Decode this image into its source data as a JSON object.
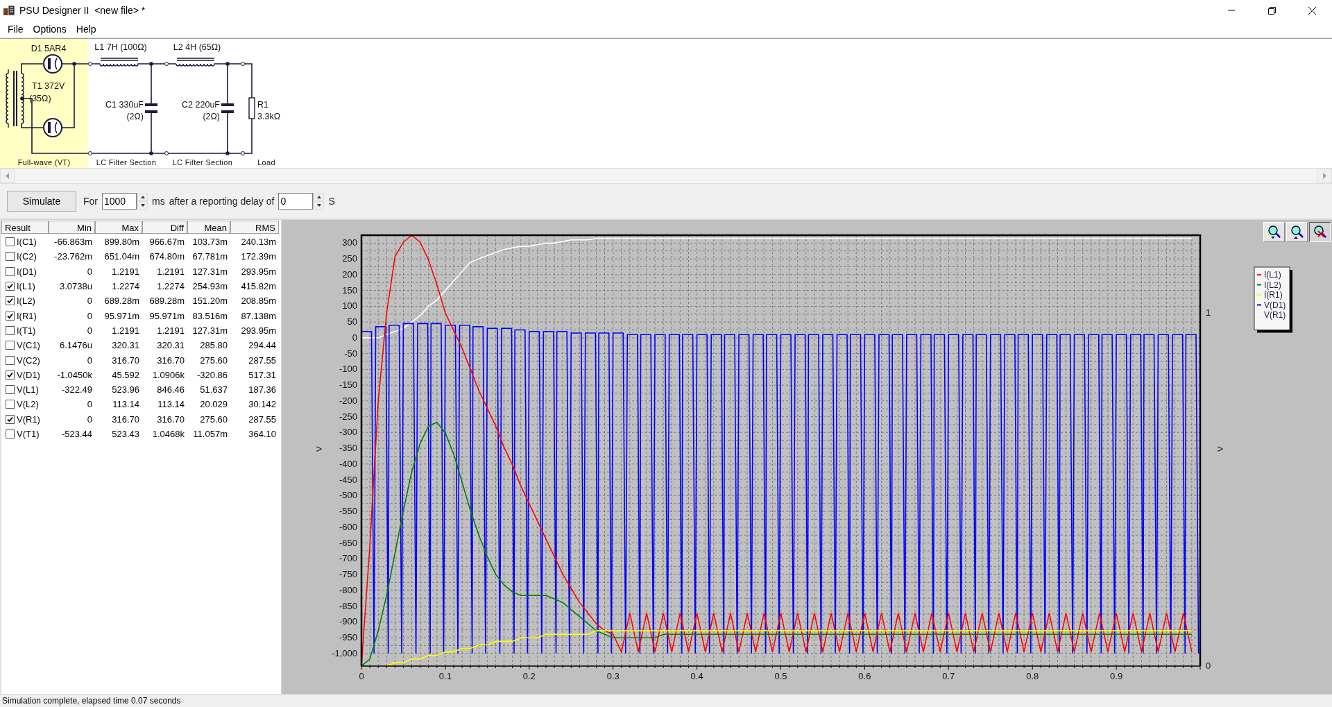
{
  "window": {
    "title": "PSU Designer II  <new file> *"
  },
  "menu": [
    "File",
    "Options",
    "Help"
  ],
  "schematic": {
    "sections": [
      {
        "kind": "rectifier",
        "label": "Full-wave (VT)",
        "selected": true,
        "tube": "D1 5AR4",
        "transformer": [
          "T1 372V",
          "(35Ω)"
        ]
      },
      {
        "kind": "lc_filter",
        "label": "LC Filter Section",
        "selected": false,
        "inductor": "L1 7H (100Ω)",
        "capacitor": [
          "C1 330uF",
          "(2Ω)"
        ]
      },
      {
        "kind": "lc_filter",
        "label": "LC Filter Section",
        "selected": false,
        "inductor": "L2 4H (65Ω)",
        "capacitor": [
          "C2 220uF",
          "(2Ω)"
        ]
      },
      {
        "kind": "load",
        "label": "Load",
        "selected": false,
        "resistor": [
          "R1",
          "3.3kΩ"
        ]
      }
    ]
  },
  "simulation": {
    "button": "Simulate",
    "for_label": "For",
    "duration": "1000",
    "duration_unit": "ms",
    "delay_label": "after a reporting delay of",
    "delay": "0",
    "delay_unit": "S"
  },
  "results": {
    "columns": [
      "Result",
      "Min",
      "Max",
      "Diff",
      "Mean",
      "RMS"
    ],
    "rows": [
      {
        "name": "I(C1)",
        "checked": false,
        "min": "-66.863m",
        "max": "899.80m",
        "diff": "966.67m",
        "mean": "103.73m",
        "rms": "240.13m"
      },
      {
        "name": "I(C2)",
        "checked": false,
        "min": "-23.762m",
        "max": "651.04m",
        "diff": "674.80m",
        "mean": "67.781m",
        "rms": "172.39m"
      },
      {
        "name": "I(D1)",
        "checked": false,
        "min": "0",
        "max": "1.2191",
        "diff": "1.2191",
        "mean": "127.31m",
        "rms": "293.95m"
      },
      {
        "name": "I(L1)",
        "checked": true,
        "min": "3.0738u",
        "max": "1.2274",
        "diff": "1.2274",
        "mean": "254.93m",
        "rms": "415.82m"
      },
      {
        "name": "I(L2)",
        "checked": true,
        "min": "0",
        "max": "689.28m",
        "diff": "689.28m",
        "mean": "151.20m",
        "rms": "208.85m"
      },
      {
        "name": "I(R1)",
        "checked": true,
        "min": "0",
        "max": "95.971m",
        "diff": "95.971m",
        "mean": "83.516m",
        "rms": "87.138m"
      },
      {
        "name": "I(T1)",
        "checked": false,
        "min": "0",
        "max": "1.2191",
        "diff": "1.2191",
        "mean": "127.31m",
        "rms": "293.95m"
      },
      {
        "name": "V(C1)",
        "checked": false,
        "min": "6.1476u",
        "max": "320.31",
        "diff": "320.31",
        "mean": "285.80",
        "rms": "294.44"
      },
      {
        "name": "V(C2)",
        "checked": false,
        "min": "0",
        "max": "316.70",
        "diff": "316.70",
        "mean": "275.60",
        "rms": "287.55"
      },
      {
        "name": "V(D1)",
        "checked": true,
        "min": "-1.0450k",
        "max": "45.592",
        "diff": "1.0906k",
        "mean": "-320.86",
        "rms": "517.31"
      },
      {
        "name": "V(L1)",
        "checked": false,
        "min": "-322.49",
        "max": "523.96",
        "diff": "846.46",
        "mean": "51.637",
        "rms": "187.36"
      },
      {
        "name": "V(L2)",
        "checked": false,
        "min": "0",
        "max": "113.14",
        "diff": "113.14",
        "mean": "20.029",
        "rms": "30.142"
      },
      {
        "name": "V(R1)",
        "checked": true,
        "min": "0",
        "max": "316.70",
        "diff": "316.70",
        "mean": "275.60",
        "rms": "287.55"
      },
      {
        "name": "V(T1)",
        "checked": false,
        "min": "-523.44",
        "max": "523.43",
        "diff": "1.0468k",
        "mean": "11.057m",
        "rms": "364.10"
      }
    ]
  },
  "chart": {
    "chart_data": {
      "type": "line",
      "grid": true,
      "legend": "right",
      "ylabel": ">",
      "y2label": ">",
      "xlim": [
        0,
        1
      ],
      "ylim": [
        -1040,
        325
      ],
      "y2lim": [
        0,
        1.22
      ],
      "xticks": [
        0,
        0.1,
        0.2,
        0.3,
        0.4,
        0.5,
        0.6,
        0.7,
        0.8,
        0.9
      ],
      "yticks": [
        300,
        250,
        200,
        150,
        100,
        50,
        0,
        -50,
        -100,
        -150,
        -200,
        -250,
        -300,
        -350,
        -400,
        -450,
        -500,
        -550,
        -600,
        -650,
        -700,
        -750,
        -800,
        -850,
        -900,
        -950,
        {
          "value": -1000,
          "label": "-1,000"
        }
      ],
      "y2ticks": [
        0,
        1
      ],
      "x": [
        0,
        0.01,
        0.02,
        0.03,
        0.04,
        0.05,
        0.06,
        0.07,
        0.08,
        0.09,
        0.1,
        0.11,
        0.12,
        0.13,
        0.14,
        0.15,
        0.16,
        0.17,
        0.18,
        0.19,
        0.2,
        0.21,
        0.22,
        0.23,
        0.24,
        0.25,
        0.26,
        0.27,
        0.28,
        0.29,
        0.3,
        0.31,
        0.32,
        0.33,
        0.34,
        0.35,
        0.36,
        0.37,
        0.38,
        0.39,
        0.4,
        0.41,
        0.42,
        0.43,
        0.44,
        0.45,
        0.46,
        0.47,
        0.48,
        0.49,
        0.5,
        0.51,
        0.52,
        0.53,
        0.54,
        0.55,
        0.56,
        0.57,
        0.58,
        0.59,
        0.6,
        0.61,
        0.62,
        0.63,
        0.64,
        0.65,
        0.66,
        0.67,
        0.68,
        0.69,
        0.7,
        0.71,
        0.72,
        0.73,
        0.74,
        0.75,
        0.76,
        0.77,
        0.78,
        0.79,
        0.8,
        0.81,
        0.82,
        0.83,
        0.84,
        0.85,
        0.86,
        0.87,
        0.88,
        0.89,
        0.9,
        0.91,
        0.92,
        0.93,
        0.94,
        0.95,
        0.96,
        0.97,
        0.98,
        0.99
      ],
      "series": [
        {
          "name": "I(L1)",
          "color": "#ff0000",
          "axis": "y2",
          "values": [
            0,
            0.34,
            0.75,
            1.0,
            1.16,
            1.2,
            1.22,
            1.2,
            1.15,
            1.08,
            1.0,
            0.95,
            0.9,
            0.84,
            0.78,
            0.73,
            0.68,
            0.62,
            0.57,
            0.51,
            0.46,
            0.41,
            0.36,
            0.31,
            0.26,
            0.22,
            0.18,
            0.15,
            0.12,
            0.1,
            0.09,
            0.04,
            0.15,
            0.04,
            0.15,
            0.04,
            0.15,
            0.04,
            0.15,
            0.04,
            0.15,
            0.04,
            0.15,
            0.04,
            0.15,
            0.04,
            0.15,
            0.04,
            0.15,
            0.04,
            0.15,
            0.04,
            0.15,
            0.04,
            0.15,
            0.04,
            0.15,
            0.04,
            0.15,
            0.04,
            0.15,
            0.04,
            0.15,
            0.04,
            0.15,
            0.04,
            0.15,
            0.04,
            0.15,
            0.04,
            0.15,
            0.04,
            0.15,
            0.04,
            0.15,
            0.04,
            0.15,
            0.04,
            0.15,
            0.04,
            0.15,
            0.04,
            0.15,
            0.04,
            0.15,
            0.04,
            0.15,
            0.04,
            0.15,
            0.04,
            0.15,
            0.04,
            0.15,
            0.04,
            0.15,
            0.04,
            0.15,
            0.04,
            0.15,
            0.04
          ]
        },
        {
          "name": "I(L2)",
          "color": "#008000",
          "axis": "y2",
          "values": [
            0,
            0.02,
            0.1,
            0.2,
            0.32,
            0.44,
            0.55,
            0.63,
            0.68,
            0.69,
            0.66,
            0.6,
            0.52,
            0.44,
            0.37,
            0.31,
            0.26,
            0.23,
            0.21,
            0.2,
            0.2,
            0.2,
            0.2,
            0.19,
            0.18,
            0.16,
            0.14,
            0.12,
            0.1,
            0.09,
            0.08,
            0.08,
            0.08,
            0.08,
            0.08,
            0.08,
            0.09,
            0.09,
            0.09,
            0.09,
            0.09,
            0.09,
            0.09,
            0.09,
            0.09,
            0.09,
            0.09,
            0.09,
            0.09,
            0.09,
            0.09,
            0.09,
            0.09,
            0.09,
            0.09,
            0.09,
            0.09,
            0.09,
            0.09,
            0.09,
            0.09,
            0.09,
            0.09,
            0.09,
            0.09,
            0.09,
            0.09,
            0.09,
            0.09,
            0.09,
            0.09,
            0.09,
            0.09,
            0.09,
            0.09,
            0.09,
            0.09,
            0.09,
            0.09,
            0.09,
            0.09,
            0.09,
            0.09,
            0.09,
            0.09,
            0.09,
            0.09,
            0.09,
            0.09,
            0.09,
            0.09,
            0.09,
            0.09,
            0.09,
            0.09,
            0.09,
            0.09,
            0.09,
            0.09,
            0.09
          ]
        },
        {
          "name": "I(R1)",
          "color": "#ffff00",
          "axis": "y2",
          "values": [
            null,
            null,
            null,
            0,
            0.01,
            0.01,
            0.02,
            0.02,
            0.03,
            0.03,
            0.04,
            0.04,
            0.05,
            0.05,
            0.06,
            0.06,
            0.07,
            0.07,
            0.07,
            0.08,
            0.08,
            0.08,
            0.09,
            0.09,
            0.09,
            0.09,
            0.09,
            0.09,
            0.1,
            0.1,
            0.1,
            0.1,
            0.1,
            0.1,
            0.1,
            0.1,
            0.1,
            0.1,
            0.1,
            0.1,
            0.1,
            0.1,
            0.1,
            0.1,
            0.1,
            0.1,
            0.1,
            0.1,
            0.1,
            0.1,
            0.1,
            0.1,
            0.1,
            0.1,
            0.1,
            0.1,
            0.1,
            0.1,
            0.1,
            0.1,
            0.1,
            0.1,
            0.1,
            0.1,
            0.1,
            0.1,
            0.1,
            0.1,
            0.1,
            0.1,
            0.1,
            0.1,
            0.1,
            0.1,
            0.1,
            0.1,
            0.1,
            0.1,
            0.1,
            0.1,
            0.1,
            0.1,
            0.1,
            0.1,
            0.1,
            0.1,
            0.1,
            0.1,
            0.1,
            0.1,
            0.1,
            0.1,
            0.1,
            0.1,
            0.1,
            0.1,
            0.1,
            0.1,
            0.1,
            0.1
          ]
        },
        {
          "name": "V(D1)",
          "color": "#0000ff",
          "x": [
            0,
            0.012,
            0.015,
            0.017,
            0.029,
            0.032,
            0.033,
            0.045,
            0.048,
            0.05,
            0.062,
            0.065,
            0.067,
            0.079,
            0.082,
            0.083,
            0.095,
            0.098,
            0.1,
            0.112,
            0.115,
            0.117,
            0.129,
            0.132,
            0.133,
            0.145,
            0.148,
            0.15,
            0.162,
            0.165,
            0.167,
            0.179,
            0.182,
            0.183,
            0.195,
            0.198,
            0.2,
            0.212,
            0.215,
            0.217,
            0.229,
            0.232,
            0.233,
            0.245,
            0.248,
            0.25,
            0.262,
            0.265,
            0.267,
            0.279,
            0.282,
            0.283,
            0.295,
            0.298,
            0.3,
            0.312,
            0.315,
            0.317,
            0.329,
            0.332,
            0.333,
            0.345,
            0.348,
            0.35,
            0.362,
            0.365,
            0.367,
            0.379,
            0.382,
            0.383,
            0.395,
            0.398,
            0.4,
            0.412,
            0.415,
            0.417,
            0.429,
            0.432,
            0.433,
            0.445,
            0.448,
            0.45,
            0.462,
            0.465,
            0.467,
            0.479,
            0.482,
            0.483,
            0.495,
            0.498,
            0.5,
            0.512,
            0.515,
            0.517,
            0.529,
            0.532,
            0.533,
            0.545,
            0.548,
            0.55,
            0.562,
            0.565,
            0.567,
            0.579,
            0.582,
            0.583,
            0.595,
            0.598,
            0.6,
            0.612,
            0.615,
            0.617,
            0.629,
            0.632,
            0.633,
            0.645,
            0.648,
            0.65,
            0.662,
            0.665,
            0.667,
            0.679,
            0.682,
            0.683,
            0.695,
            0.698,
            0.7,
            0.712,
            0.715,
            0.717,
            0.729,
            0.732,
            0.733,
            0.745,
            0.748,
            0.75,
            0.762,
            0.765,
            0.767,
            0.779,
            0.782,
            0.783,
            0.795,
            0.798,
            0.8,
            0.812,
            0.815,
            0.817,
            0.829,
            0.832,
            0.833,
            0.845,
            0.848,
            0.85,
            0.862,
            0.865,
            0.867,
            0.879,
            0.882,
            0.883,
            0.895,
            0.898,
            0.9,
            0.912,
            0.915,
            0.917,
            0.929,
            0.932,
            0.933,
            0.945,
            0.948,
            0.95,
            0.962,
            0.965,
            0.967,
            0.979,
            0.982,
            0.983,
            0.995,
            0.998
          ],
          "values": [
            20,
            20,
            -1000,
            35,
            35,
            -1000,
            40,
            40,
            -1000,
            45,
            45,
            -1000,
            45,
            45,
            -1000,
            45,
            45,
            -1000,
            40,
            40,
            -1000,
            40,
            40,
            -1000,
            35,
            35,
            -1000,
            30,
            30,
            -1000,
            30,
            30,
            -1000,
            25,
            25,
            -1000,
            20,
            20,
            -1000,
            20,
            20,
            -1000,
            20,
            20,
            -1000,
            15,
            15,
            -1000,
            15,
            15,
            -1000,
            15,
            15,
            -1000,
            15,
            15,
            -1000,
            10,
            10,
            -1000,
            10,
            10,
            -1000,
            10,
            10,
            -1000,
            10,
            10,
            -1000,
            10,
            10,
            -1000,
            10,
            10,
            -1000,
            10,
            10,
            -1000,
            10,
            10,
            -1000,
            10,
            10,
            -1000,
            10,
            10,
            -1000,
            10,
            10,
            -1000,
            10,
            10,
            -1000,
            10,
            10,
            -1000,
            10,
            10,
            -1000,
            10,
            10,
            -1000,
            10,
            10,
            -1000,
            10,
            10,
            -1000,
            10,
            10,
            -1000,
            10,
            10,
            -1000,
            10,
            10,
            -1000,
            10,
            10,
            -1000,
            10,
            10,
            -1000,
            10,
            10,
            -1000,
            10,
            10,
            -1000,
            10,
            10,
            -1000,
            10,
            10,
            -1000,
            10,
            10,
            -1000,
            10,
            10,
            -1000,
            10,
            10,
            -1000,
            10,
            10,
            -1000,
            10,
            10,
            -1000,
            10,
            10,
            -1000,
            10,
            10,
            -1000,
            10,
            10,
            -1000,
            10,
            10,
            -1000,
            10,
            10,
            -1000,
            10,
            10,
            -1000,
            10,
            10,
            -1000,
            10,
            10,
            -1000,
            10,
            10,
            -1000,
            10,
            10,
            -1000
          ]
        },
        {
          "name": "V(R1)",
          "color": "#ffffff",
          "values": [
            0,
            0,
            0,
            10,
            20,
            30,
            50,
            70,
            100,
            120,
            150,
            180,
            210,
            240,
            250,
            260,
            270,
            280,
            285,
            290,
            290,
            295,
            300,
            300,
            305,
            310,
            310,
            310,
            315,
            315,
            315,
            315,
            315,
            315,
            315,
            315,
            315,
            315,
            315,
            315,
            315,
            315,
            315,
            315,
            315,
            315,
            315,
            315,
            315,
            315,
            315,
            315,
            315,
            315,
            315,
            315,
            315,
            315,
            315,
            315,
            315,
            315,
            315,
            315,
            315,
            315,
            315,
            315,
            315,
            315,
            315,
            315,
            315,
            315,
            315,
            315,
            315,
            315,
            315,
            315,
            315,
            315,
            315,
            315,
            315,
            315,
            315,
            315,
            315,
            315,
            315,
            315,
            315,
            315,
            315,
            315,
            315,
            315,
            315,
            315
          ]
        }
      ]
    }
  },
  "status_bar": "Simulation complete, elapsed time 0.07 seconds"
}
